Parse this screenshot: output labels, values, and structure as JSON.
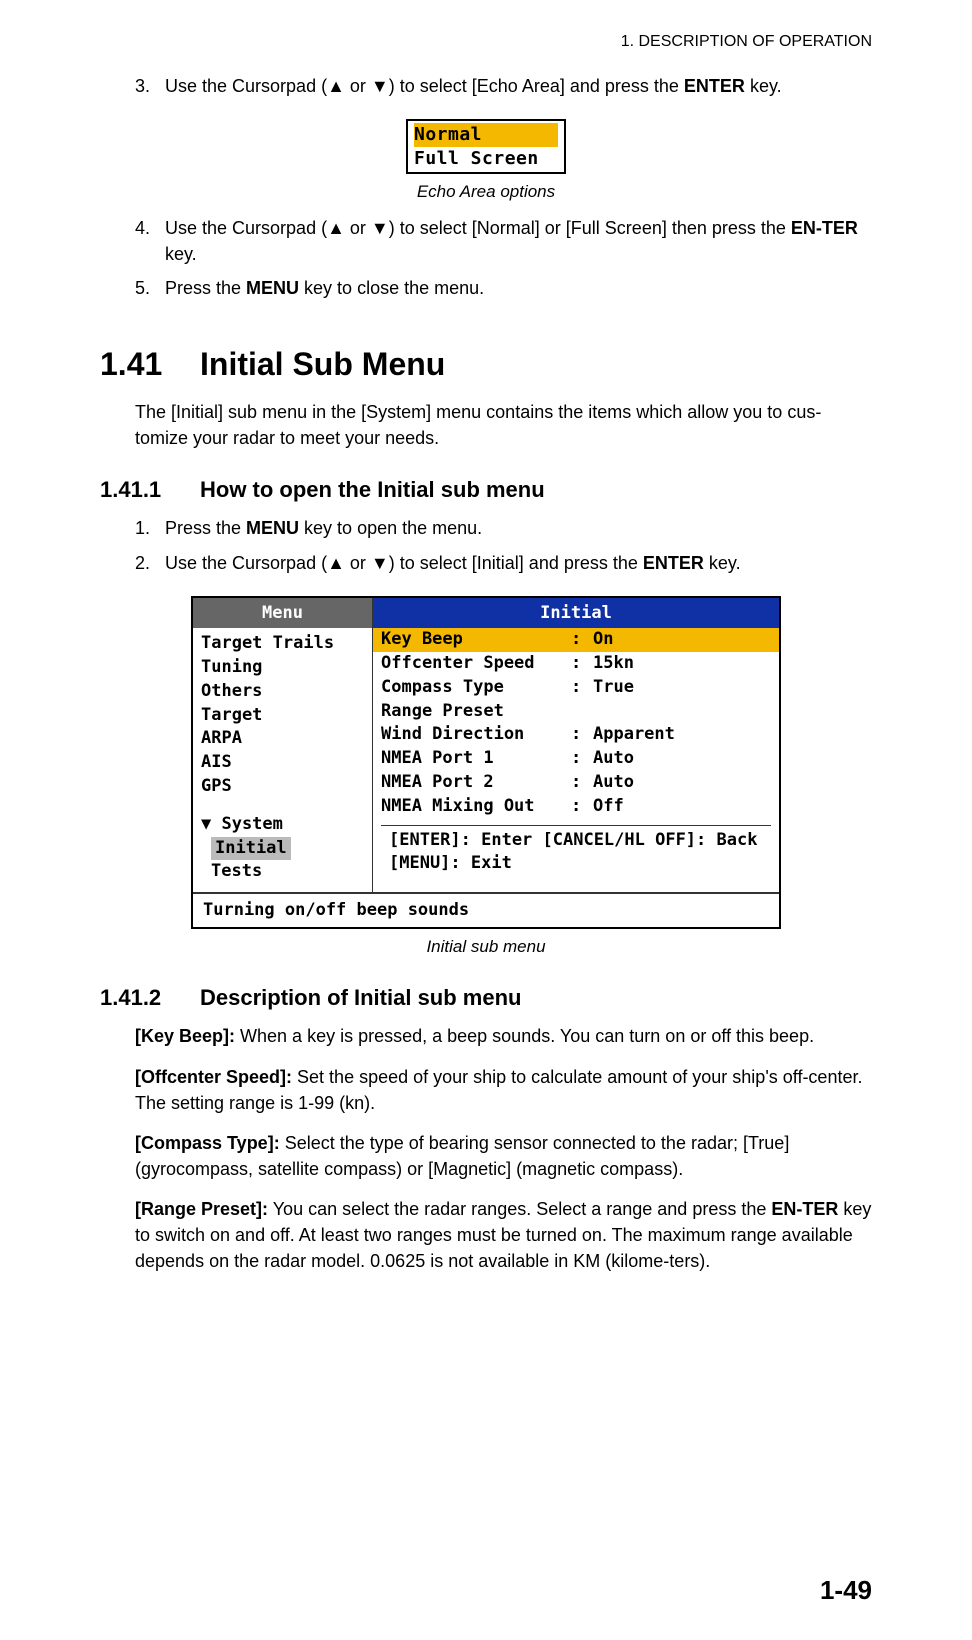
{
  "header": {
    "chapter": "1.  DESCRIPTION OF OPERATION"
  },
  "steps_top": [
    {
      "num": "3.",
      "pre": "Use the Cursorpad (",
      "mid": " or ",
      "post": ") to select [Echo Area] and press the ",
      "bold1": "ENTER",
      "tail": " key."
    }
  ],
  "echo_options": {
    "opt1": "Normal",
    "opt2": "Full Screen",
    "caption": "Echo Area options"
  },
  "steps_mid": [
    {
      "num": "4.",
      "pre": "Use the Cursorpad (",
      "mid": " or ",
      "post": ") to select [Normal] or [Full Screen] then press the ",
      "bold1": "EN-TER",
      "tail": " key."
    },
    {
      "num": "5.",
      "pre": "Press the ",
      "bold1": "MENU",
      "tail": " key to close the menu."
    }
  ],
  "section141": {
    "num": "1.41",
    "title": "Initial Sub Menu",
    "intro": "The [Initial] sub menu in the [System] menu contains the items which allow you to cus-tomize your radar to meet your needs."
  },
  "section1411": {
    "num": "1.41.1",
    "title": "How to open the Initial sub menu",
    "steps": [
      {
        "num": "1.",
        "pre": "Press the ",
        "bold1": "MENU",
        "tail": " key to open the menu."
      },
      {
        "num": "2.",
        "pre": "Use the Cursorpad (",
        "mid": " or ",
        "post": ") to select [Initial] and press the ",
        "bold1": "ENTER",
        "tail": " key."
      }
    ]
  },
  "menu_ui": {
    "left_header": "Menu",
    "left_items": [
      "Target Trails",
      "Tuning",
      "Others",
      "Target",
      "ARPA",
      "AIS",
      "GPS"
    ],
    "left_system": "▼ System",
    "left_initial": "Initial",
    "left_tests": "Tests",
    "right_header": "Initial",
    "right_rows": [
      {
        "label": "Key Beep",
        "val": "On",
        "highlight": true
      },
      {
        "label": "Offcenter Speed",
        "val": "15kn"
      },
      {
        "label": "Compass Type",
        "val": "True"
      },
      {
        "label": "Range Preset",
        "val": ""
      },
      {
        "label": "Wind Direction",
        "val": "Apparent"
      },
      {
        "label": "NMEA Port 1",
        "val": "Auto"
      },
      {
        "label": "NMEA Port 2",
        "val": "Auto"
      },
      {
        "label": "NMEA Mixing Out",
        "val": "Off"
      }
    ],
    "footer1": "[ENTER]: Enter [CANCEL/HL OFF]: Back",
    "footer2": "[MENU]: Exit",
    "status": "Turning on/off beep sounds",
    "caption": "Initial sub menu"
  },
  "section1412": {
    "num": "1.41.2",
    "title": "Description of Initial sub menu"
  },
  "descriptions": {
    "key_beep": {
      "label": "[Key Beep]:",
      "text": " When a key is pressed, a beep sounds. You can turn on or off this beep."
    },
    "offcenter": {
      "label": "[Offcenter Speed]:",
      "text": " Set the speed of your ship to calculate amount of your ship's off-center. The setting range is 1-99 (kn)."
    },
    "compass": {
      "label": "[Compass Type]:",
      "text": " Select the type of bearing sensor connected to the radar; [True] (gyrocompass, satellite compass) or [Magnetic] (magnetic compass)."
    },
    "range": {
      "label": "[Range Preset]:",
      "text1": " You can select the radar ranges. Select a range and press the ",
      "bold": "EN-TER",
      "text2": " key to switch on and off. At least two ranges must be turned on. The maximum range available depends on the radar model. 0.0625 is not available in KM (kilome-ters)."
    }
  },
  "page_number": "1-49"
}
